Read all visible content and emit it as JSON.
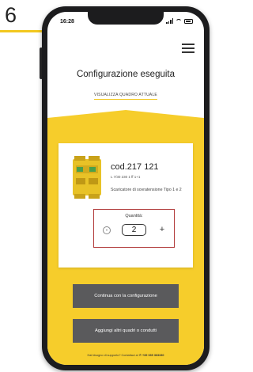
{
  "step": {
    "number": "6"
  },
  "colors": {
    "accent": "#f6cd2b",
    "button": "#5a5a5c",
    "highlight": "#b13a3a"
  },
  "status_bar": {
    "time": "16:28"
  },
  "header": {
    "menu_icon": "hamburger-menu-icon",
    "title": "Configurazione eseguita",
    "view_link": "VISUALIZZA QUADRO ATTUALE"
  },
  "product": {
    "code": "cod.217 121",
    "subcode": "L 7/30 230 1 ff 1+1",
    "description": "Scaricatore di sovratensione Tipo 1 e 2",
    "quantity_label": "Quantità:",
    "quantity": "2",
    "minus": "-",
    "plus": "+"
  },
  "actions": {
    "continue_label": "Continua con la configurazione",
    "add_label": "Aggiungi altri quadri o condutti"
  },
  "footer": {
    "text": "Hai bisogno di supporto? Contattaci al",
    "phone": "+39 035 363330"
  }
}
